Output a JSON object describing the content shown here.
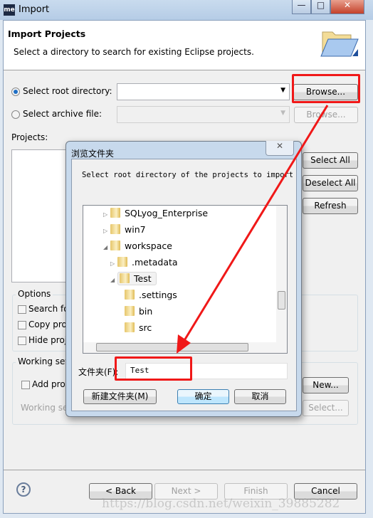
{
  "window": {
    "title": "Import",
    "app_icon_text": "me",
    "minimize": "—",
    "maximize": "□",
    "close": "✕"
  },
  "header": {
    "title": "Import Projects",
    "description": "Select a directory to search for existing Eclipse projects."
  },
  "source": {
    "root_label": "Select root directory:",
    "root_value": "",
    "root_selected": true,
    "archive_label": "Select archive file:",
    "archive_value": "",
    "browse": "Browse...",
    "browse_disabled": "Browse..."
  },
  "projects": {
    "label": "Projects:",
    "select_all": "Select All",
    "deselect_all": "Deselect All",
    "refresh": "Refresh"
  },
  "options": {
    "label": "Options",
    "items": [
      "Search fo",
      "Copy pro",
      "Hide proj"
    ]
  },
  "working_sets": {
    "label": "Working set",
    "add": "Add pro",
    "working_sets_label": "Working se",
    "new": "New...",
    "select": "Select..."
  },
  "footer": {
    "help": "?",
    "back": "< Back",
    "next": "Next >",
    "finish": "Finish",
    "cancel": "Cancel"
  },
  "watermark": "https://blog.csdn.net/weixin_39885282",
  "dialog": {
    "title": "浏览文件夹",
    "close": "✕",
    "prompt": "Select root directory of the projects to import",
    "tree": [
      {
        "label": "SQLyog_Enterprise",
        "expanded": false
      },
      {
        "label": "win7",
        "expanded": false
      },
      {
        "label": "workspace",
        "expanded": true
      },
      {
        "label": ".metadata",
        "expanded": false
      },
      {
        "label": "Test",
        "expanded": true,
        "selected": true
      },
      {
        "label": ".settings"
      },
      {
        "label": "bin"
      },
      {
        "label": "src"
      }
    ],
    "folder_label": "文件夹(F):",
    "folder_value": "Test",
    "new_folder": "新建文件夹(M)",
    "ok": "确定",
    "cancel": "取消"
  },
  "colors": {
    "annotation": "#f01818",
    "accent": "#1f6fc5"
  }
}
